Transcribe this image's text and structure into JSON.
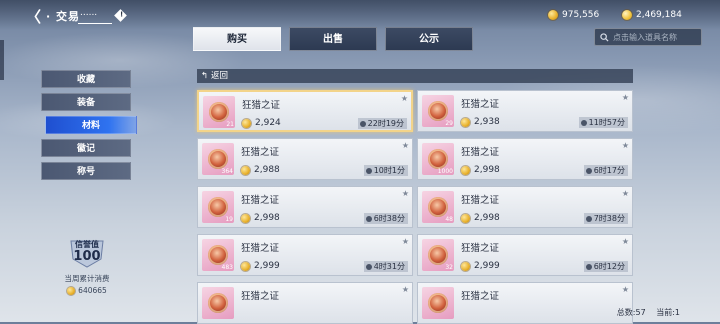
{
  "header": {
    "back_glyph": "〈",
    "title": "· 交易",
    "title_dots": "......",
    "info_glyph": "!",
    "currencies": [
      {
        "icon": "gold-coin-icon",
        "value": "975,556"
      },
      {
        "icon": "diamond-coin-icon",
        "value": "2,469,184"
      }
    ]
  },
  "tabs": [
    {
      "label": "购买",
      "active": true
    },
    {
      "label": "出售",
      "active": false
    },
    {
      "label": "公示",
      "active": false
    }
  ],
  "search": {
    "placeholder": "点击输入道具名称"
  },
  "sidebar": {
    "items": [
      {
        "label": "收藏",
        "active": false
      },
      {
        "label": "装备",
        "active": false
      },
      {
        "label": "材料",
        "active": true
      },
      {
        "label": "徽记",
        "active": false
      },
      {
        "label": "称号",
        "active": false
      }
    ]
  },
  "reputation": {
    "label": "信誉值",
    "value": "100",
    "weekly_label": "当周累计消费",
    "weekly_amount": "640665"
  },
  "back_bar": {
    "label": "返回"
  },
  "listings": [
    {
      "name": "狂猎之证",
      "qty": "21",
      "price": "2,924",
      "time": "22时19分",
      "selected": true
    },
    {
      "name": "狂猎之证",
      "qty": "29",
      "price": "2,938",
      "time": "11时57分",
      "selected": false
    },
    {
      "name": "狂猎之证",
      "qty": "364",
      "price": "2,988",
      "time": "10时1分",
      "selected": false
    },
    {
      "name": "狂猎之证",
      "qty": "1000",
      "price": "2,998",
      "time": "6时17分",
      "selected": false
    },
    {
      "name": "狂猎之证",
      "qty": "19",
      "price": "2,998",
      "time": "6时38分",
      "selected": false
    },
    {
      "name": "狂猎之证",
      "qty": "48",
      "price": "2,998",
      "time": "7时38分",
      "selected": false
    },
    {
      "name": "狂猎之证",
      "qty": "483",
      "price": "2,999",
      "time": "4时31分",
      "selected": false
    },
    {
      "name": "狂猎之证",
      "qty": "32",
      "price": "2,999",
      "time": "6时12分",
      "selected": false
    },
    {
      "name": "狂猎之证",
      "qty": "",
      "price": "",
      "time": "",
      "selected": false
    },
    {
      "name": "狂猎之证",
      "qty": "",
      "price": "",
      "time": "",
      "selected": false
    }
  ],
  "footer": {
    "total": "总数:57",
    "page": "当前:1"
  }
}
